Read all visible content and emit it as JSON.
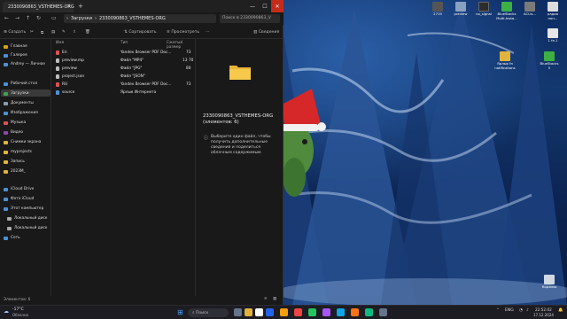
{
  "explorer": {
    "tab_title": "2330090863_VSTHEMES-ORG",
    "tab_close": "×",
    "new_tab": "+",
    "window_buttons": {
      "minimize": "—",
      "maximize": "☐",
      "close": "✕"
    },
    "breadcrumb": [
      "Загрузки",
      "2330090863_VSTHEMES-ORG"
    ],
    "breadcrumb_sep": "›",
    "search_placeholder": "Поиск в 2330090863_V",
    "toolbar": {
      "create": "Создать",
      "sort": "Сортировать",
      "view": "Просмотреть",
      "details": "Сведения"
    },
    "sidebar": [
      {
        "label": "Главная",
        "color": "#d4a017"
      },
      {
        "label": "Галерея",
        "color": "#4a90d9"
      },
      {
        "label": "Andrey — Личное",
        "color": "#4a90d9"
      },
      {
        "label": "Рабочий стол",
        "color": "#4a90d9"
      },
      {
        "label": "Загрузки",
        "color": "#3fa34d"
      },
      {
        "label": "Документы",
        "color": "#8a9bb0"
      },
      {
        "label": "Изображения",
        "color": "#4a90d9"
      },
      {
        "label": "Музыка",
        "color": "#d9534f"
      },
      {
        "label": "Видео",
        "color": "#8e44ad"
      },
      {
        "label": "Снимки экрана",
        "color": "#e2b33c"
      },
      {
        "label": "myprojects",
        "color": "#e2b33c"
      },
      {
        "label": "Запись",
        "color": "#e2b33c"
      },
      {
        "label": "2023М_",
        "color": "#e2b33c"
      },
      {
        "label": "iCloud Drive",
        "color": "#4a90d9"
      },
      {
        "label": "Фото iCloud",
        "color": "#4a90d9"
      },
      {
        "label": "Этот компьютер",
        "color": "#4a90d9"
      },
      {
        "label": "Локальный диск",
        "color": "#aaaaaa"
      },
      {
        "label": "Локальный диск",
        "color": "#aaaaaa"
      },
      {
        "label": "Сеть",
        "color": "#4a90d9"
      }
    ],
    "columns": {
      "name": "Имя",
      "type": "Тип",
      "size": "Сжатый размер"
    },
    "files": [
      {
        "name": "Еп",
        "type": "Yandex Browser PDF Doc...",
        "size": "73",
        "color": "#d9534f"
      },
      {
        "name": "preview.mp",
        "type": "Файл \"MP4\"",
        "size": "13 70",
        "color": "#bbbbbb"
      },
      {
        "name": "preview",
        "type": "Файл \"JPG\"",
        "size": "80",
        "color": "#bbbbbb"
      },
      {
        "name": "project.json",
        "type": "Файл \"JSON\"",
        "size": "",
        "color": "#bbbbbb"
      },
      {
        "name": "RU",
        "type": "Yandex Browser PDF Doc...",
        "size": "73",
        "color": "#d9534f"
      },
      {
        "name": "source",
        "type": "Ярлык Интернета",
        "size": "",
        "color": "#4a90d9"
      }
    ],
    "detail": {
      "title": "2330090863_VSTHEMES-ORG (элементов: 6)",
      "info": "Выберите один файл, чтобы получить дополнительные сведения и поделиться облачным содержимым."
    },
    "status": "Элементов: 6"
  },
  "desktop_icons": [
    {
      "label": "2719",
      "color": "#555555"
    },
    {
      "label": "preview",
      "color": "#8aa0c0"
    },
    {
      "label": "no_signal",
      "color": "#2c2c2c"
    },
    {
      "label": "BlueStacks Multi-Insta...",
      "color": "#3cb043"
    },
    {
      "label": "ACLis...",
      "color": "#7a7a7a"
    },
    {
      "label": "радио поп...",
      "color": "#dddddd"
    },
    {
      "label": "1 fe.1",
      "color": "#e6e6e6"
    },
    {
      "label": "Ярлык fn notifications",
      "color": "#e2b33c"
    },
    {
      "label": "BlueStacks 5",
      "color": "#3cb043"
    },
    {
      "label": "Корзина",
      "color": "#cfd8e3"
    }
  ],
  "taskbar": {
    "weather_temp": "-17°C",
    "weather_desc": "Облачно",
    "search_placeholder": "Поиск",
    "lang": "ENG",
    "time": "22:52:02",
    "date": "17.12.2024",
    "apps": [
      "#3b82f6",
      "#e2b33c",
      "#ffffff",
      "#2563eb",
      "#f59e0b",
      "#ef4444",
      "#22c55e",
      "#a855f7",
      "#0ea5e9",
      "#f97316",
      "#64748b",
      "#10b981"
    ]
  }
}
